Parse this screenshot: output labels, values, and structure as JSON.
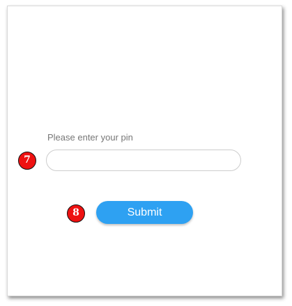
{
  "form": {
    "pin_label": "Please enter your pin",
    "pin_value": "",
    "submit_label": "Submit"
  },
  "markers": {
    "pin": "7",
    "submit": "8"
  },
  "colors": {
    "accent": "#2ea1f2",
    "marker": "#ee1111"
  }
}
